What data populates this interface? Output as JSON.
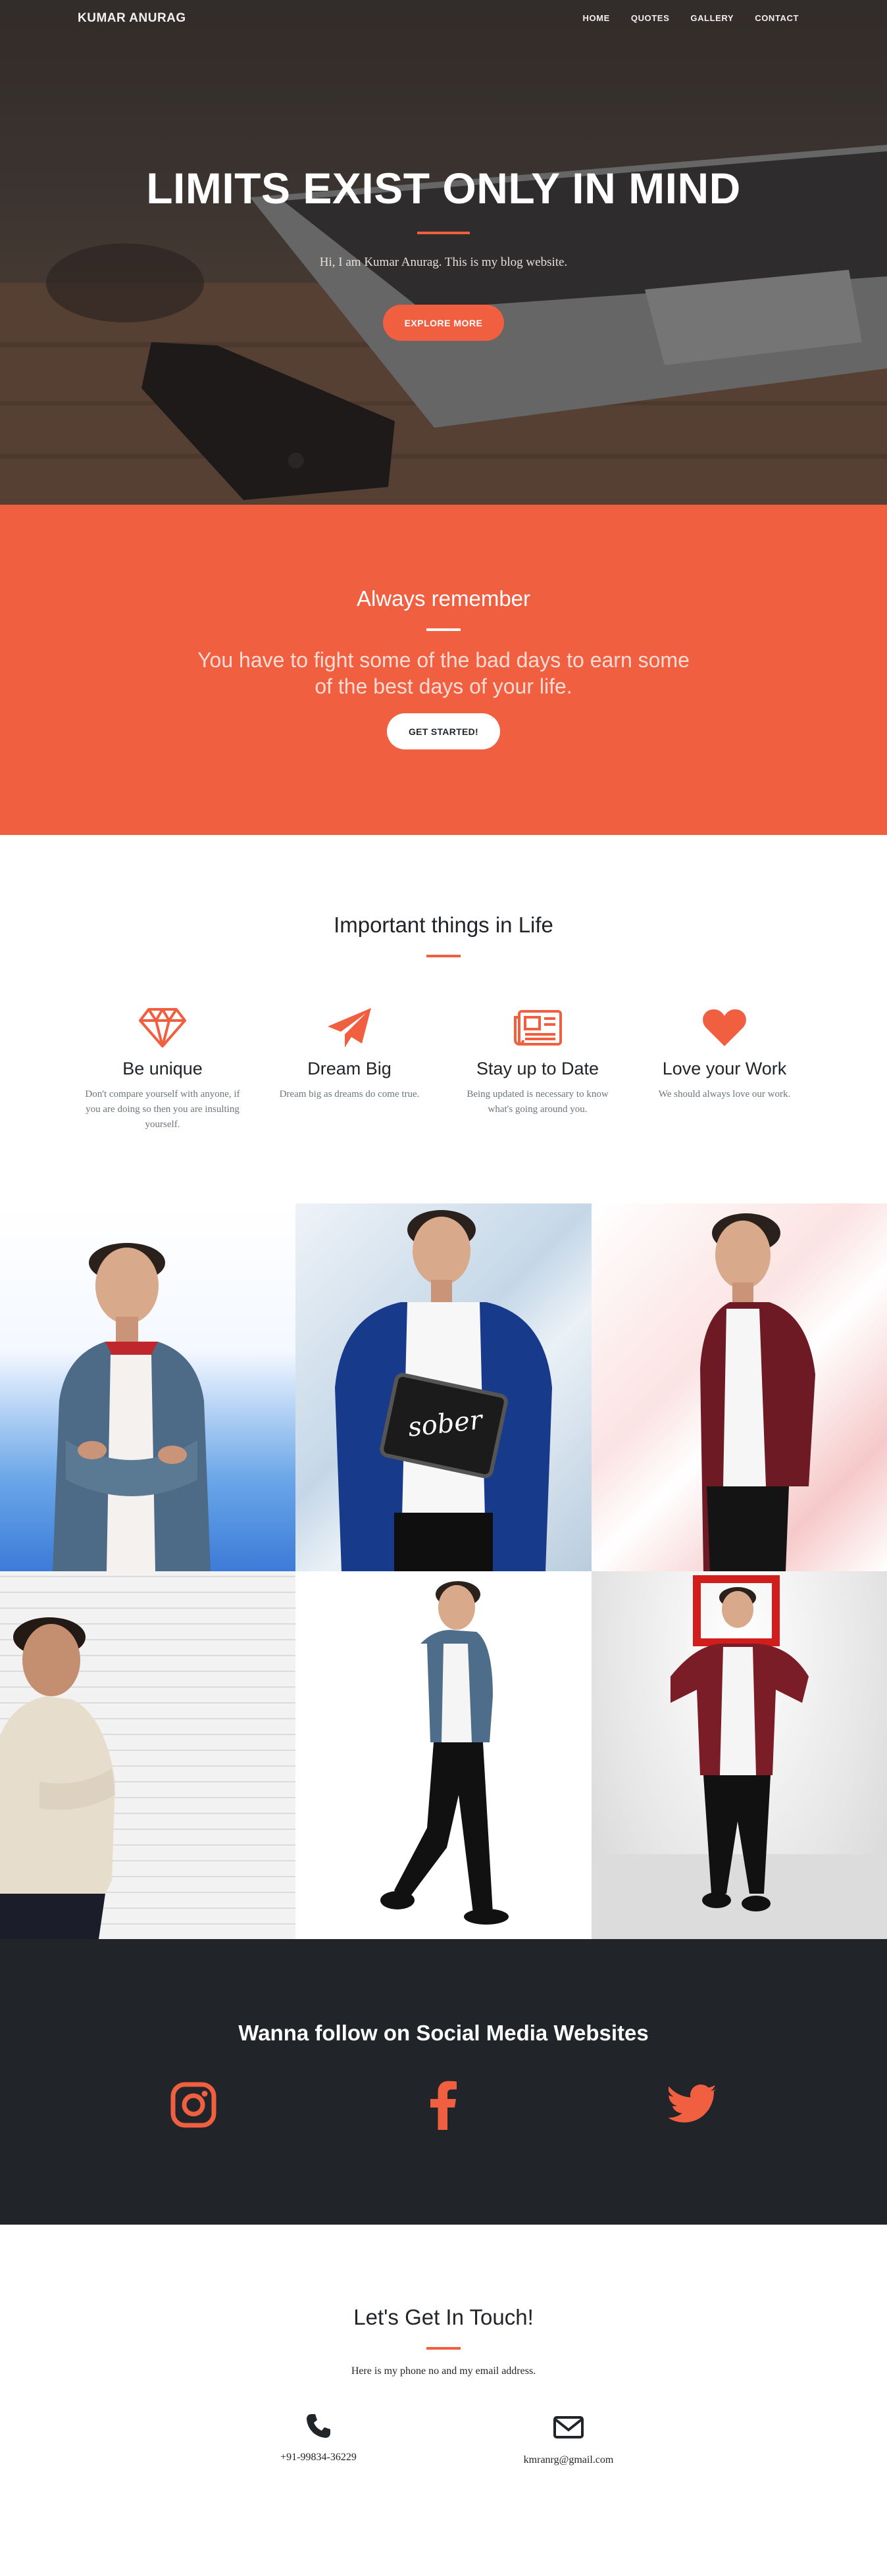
{
  "nav": {
    "brand": "KUMAR ANURAG",
    "links": [
      "HOME",
      "QUOTES",
      "GALLERY",
      "CONTACT"
    ]
  },
  "hero": {
    "title": "LIMITS EXIST ONLY IN MIND",
    "subtitle": "Hi, I am Kumar Anurag. This is my blog website.",
    "button": "EXPLORE MORE"
  },
  "remember": {
    "heading": "Always remember",
    "quote": "You have to fight some of the bad days to earn some of the best days of your life.",
    "button": "GET STARTED!"
  },
  "services": {
    "heading": "Important things in Life",
    "items": [
      {
        "icon": "diamond-icon",
        "title": "Be unique",
        "text": "Don't compare yourself with anyone, if you are doing so then you are insulting yourself."
      },
      {
        "icon": "paper-plane-icon",
        "title": "Dream Big",
        "text": "Dream big as dreams do come true."
      },
      {
        "icon": "newspaper-icon",
        "title": "Stay up to Date",
        "text": "Being updated is necessary to know what's going around you."
      },
      {
        "icon": "heart-icon",
        "title": "Love your Work",
        "text": "We should always love our work."
      }
    ]
  },
  "gallery": {
    "sign_text": "sober"
  },
  "social": {
    "heading": "Wanna follow on Social Media Websites",
    "icons": [
      "instagram-icon",
      "facebook-icon",
      "twitter-icon"
    ]
  },
  "contact": {
    "heading": "Let's Get In Touch!",
    "lead": "Here is my phone no and my email address.",
    "phone": "+91-99834-36229",
    "email": "kmranrg@gmail.com"
  },
  "colors": {
    "accent": "#f05f40",
    "dark": "#212529",
    "muted": "#6c757d"
  }
}
